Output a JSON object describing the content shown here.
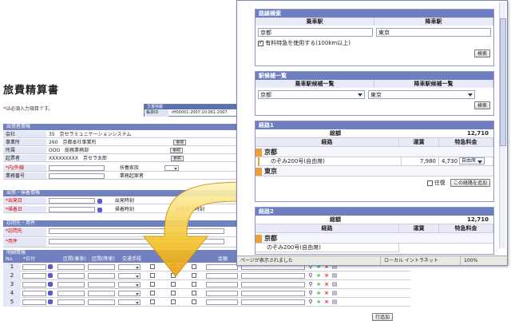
{
  "form": {
    "title": "旅費精算書",
    "note_mark": "*",
    "note_text": "は必須入力項目です。",
    "summary": {
      "header": "文書情報",
      "label": "帳票ID",
      "value": "rff00001:2007:10:061:2007"
    },
    "applicant": {
      "header": "出張者情報",
      "rows": [
        {
          "label": "会社",
          "value": "35　京セラミュニケーションシステム"
        },
        {
          "label": "事業所",
          "value": "260　京都本社事業所",
          "button": "参照"
        },
        {
          "label": "所属",
          "value": "OOO　総務業務部",
          "button": "参照"
        },
        {
          "label": "起票者",
          "value": "XXXXXXXXX　京セラ太郎",
          "button": "参照"
        },
        {
          "label": "*内/外線",
          "value": "",
          "extra_label": "扶養家族"
        },
        {
          "label": "業務番号",
          "value": "",
          "extra_label": "業務起案者"
        }
      ]
    },
    "trip": {
      "header": "出張・帰着情報",
      "rows": [
        {
          "label": "*出発日",
          "mid_label": "出発時刻"
        },
        {
          "label": "*帰着日",
          "mid_label": "帰着時刻",
          "right_label": "帰着遅了時刻"
        }
      ]
    },
    "purpose": {
      "header": "訪問先・用件",
      "rows": [
        {
          "label": "*訪問先"
        },
        {
          "label": "*用件"
        }
      ]
    },
    "detail": {
      "header": "明細情報",
      "columns": [
        "No.",
        "*日付",
        "区間(乗車)",
        "区間(降車)",
        "交通手段",
        "",
        "",
        "",
        "",
        "金額",
        "備考"
      ],
      "rows": [
        "1",
        "2",
        "3",
        "4",
        "5"
      ],
      "add_button": "行追加"
    }
  },
  "popup": {
    "route_search": {
      "header": "路線検索",
      "board_label": "乗車駅",
      "alight_label": "降車駅",
      "board_value": "京都",
      "alight_value": "東京",
      "express_label": "有料特急を使用する(100km以上)",
      "search_button": "検索"
    },
    "candidates": {
      "header": "駅候補一覧",
      "board_label": "乗車駅候補一覧",
      "alight_label": "降車駅候補一覧",
      "board_value": "京都",
      "alight_value": "東京",
      "search_button": "検索"
    },
    "route1": {
      "header": "経路1",
      "total_label": "総額",
      "total_value": "12,710",
      "col_route": "経路",
      "col_fare": "運賃",
      "col_express": "特急料金",
      "from_station": "京都",
      "train": "のぞみ200号(自由席)",
      "fare": "7,980",
      "express_fee": "4,730",
      "seat": "自由席",
      "to_station": "東京",
      "roundtrip_label": "往復",
      "add_button": "この経路を追加"
    },
    "route2": {
      "header": "経路2",
      "total_label": "総額",
      "total_value": "12,710",
      "col_route": "経路",
      "col_fare": "運賃",
      "col_express": "特急料金",
      "from_station": "京都",
      "train": "のぞみ200号(自由席)"
    },
    "status": {
      "text": "ページが表示されました",
      "zone": "ローカル イントラネット",
      "zoom": "100%"
    }
  }
}
